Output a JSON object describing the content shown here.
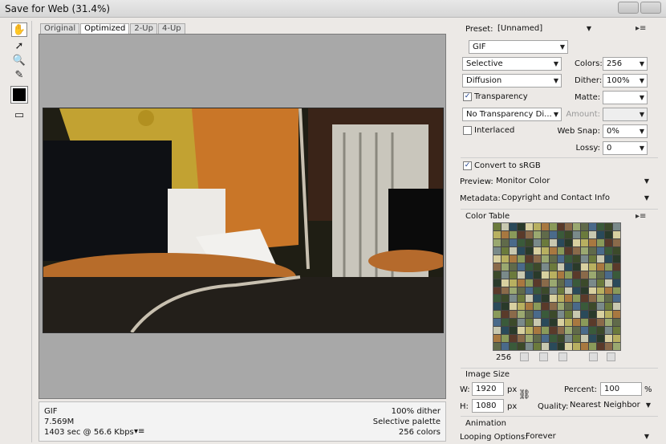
{
  "window": {
    "title": "Save for Web (31.4%)"
  },
  "tabs": [
    "Original",
    "Optimized",
    "2-Up",
    "4-Up"
  ],
  "info": {
    "format": "GIF",
    "size": "7.569M",
    "time": "1403 sec @ 56.6 Kbps",
    "dither": "100% dither",
    "palette": "Selective palette",
    "colors": "256 colors"
  },
  "panel": {
    "preset_label": "Preset:",
    "preset_value": "[Unnamed]",
    "format": "GIF",
    "reduction": "Selective",
    "colors_label": "Colors:",
    "colors_value": "256",
    "dither_algo": "Diffusion",
    "dither_label": "Dither:",
    "dither_value": "100%",
    "transparency_label": "Transparency",
    "matte_label": "Matte:",
    "matte_value": "",
    "trans_dither": "No Transparency Di...",
    "amount_label": "Amount:",
    "amount_value": "",
    "interlaced_label": "Interlaced",
    "websnap_label": "Web Snap:",
    "websnap_value": "0%",
    "lossy_label": "Lossy:",
    "lossy_value": "0",
    "srgb_label": "Convert to sRGB",
    "preview_label": "Preview:",
    "preview_value": "Monitor Color",
    "metadata_label": "Metadata:",
    "metadata_value": "Copyright and Contact Info",
    "color_table_label": "Color Table",
    "color_count": "256",
    "image_size_label": "Image Size",
    "w_label": "W:",
    "w_value": "1920",
    "h_label": "H:",
    "h_value": "1080",
    "px": "px",
    "percent_label": "Percent:",
    "percent_value": "100",
    "percent_sign": "%",
    "quality_label": "Quality:",
    "quality_value": "Nearest Neighbor",
    "animation_label": "Animation",
    "looping_label": "Looping Options:",
    "looping_value": "Forever"
  },
  "colors": {
    "palette": [
      "#6b7a3c",
      "#8a9a5a",
      "#3c4a2a",
      "#b8b060",
      "#4a6a8a",
      "#2a3a2a",
      "#9aa870",
      "#c8c8b0",
      "#5a3a2a",
      "#7a8a8a",
      "#a87840",
      "#3a5a3a",
      "#d8d0a0",
      "#606a4a",
      "#2a4a5a",
      "#8a6a4a"
    ]
  }
}
